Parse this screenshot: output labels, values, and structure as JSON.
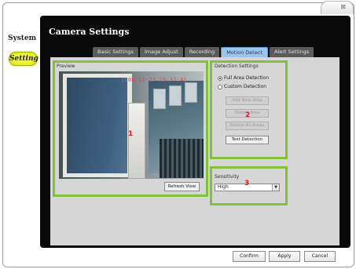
{
  "window": {
    "close_glyph": "⊠"
  },
  "sidebar": {
    "items": [
      {
        "label": "System"
      },
      {
        "label": "Setting"
      }
    ]
  },
  "panel": {
    "title": "Camera Settings"
  },
  "tabs": [
    {
      "label": "Basic Settings"
    },
    {
      "label": "Image Adjust"
    },
    {
      "label": "Recording"
    },
    {
      "label": "Motion Detect"
    },
    {
      "label": "Alert Settings"
    }
  ],
  "active_tab": "Motion Detect",
  "preview": {
    "label": "Preview",
    "timestamp": "2008-12-23 15:37:41",
    "marker": "1",
    "refresh_label": "Refresh View"
  },
  "detection": {
    "label": "Detection Settings",
    "options": [
      {
        "label": "Full Area Detection"
      },
      {
        "label": "Custom Detection"
      }
    ],
    "selected": "Full Area Detection",
    "buttons": [
      {
        "label": "Add New Area"
      },
      {
        "label": "Delete Area"
      },
      {
        "label": "Delete All Areas"
      },
      {
        "label": "Test Detection"
      }
    ],
    "marker": "2"
  },
  "sensitivity": {
    "label": "Sensitivity",
    "value": "High",
    "marker": "3"
  },
  "footer": {
    "confirm_label": "Confirm",
    "apply_label": "Apply",
    "cancel_label": "Cancel"
  },
  "colors": {
    "highlight": "#82c23a",
    "active_tab": "#9ec4e6",
    "sidebar_active": "#d8e800",
    "marker": "#e81818"
  }
}
